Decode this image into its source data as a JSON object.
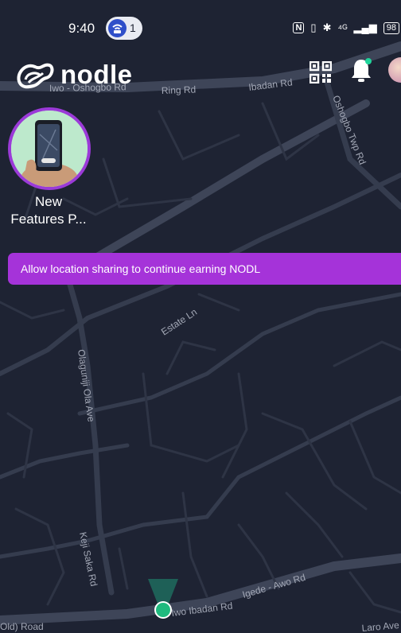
{
  "status_bar": {
    "time": "9:40",
    "hotspot_count": "1",
    "nfc": "N",
    "bluetooth": "✱",
    "network": "⁴ᴳ",
    "battery": "98"
  },
  "header": {
    "logo_text": "nodle"
  },
  "story": {
    "label": "New Features P..."
  },
  "banner": {
    "text": "Allow location sharing to continue earning NODL"
  },
  "map": {
    "streets": [
      "Iwo - Oshogbo Rd",
      "Ring Rd",
      "Ibadan Rd",
      "Oshogbo Twp Rd",
      "Estate Ln",
      "Olaguniji Ola Ave",
      "Keji Saka Rd",
      "Iwo Ibadan Rd",
      "Igede - Awo Rd",
      "Old) Road",
      "Laro Ave"
    ]
  },
  "colors": {
    "map_bg": "#1e2333",
    "road": "#3b4254",
    "banner": "#a533d9",
    "accent_green": "#1fd49a"
  }
}
